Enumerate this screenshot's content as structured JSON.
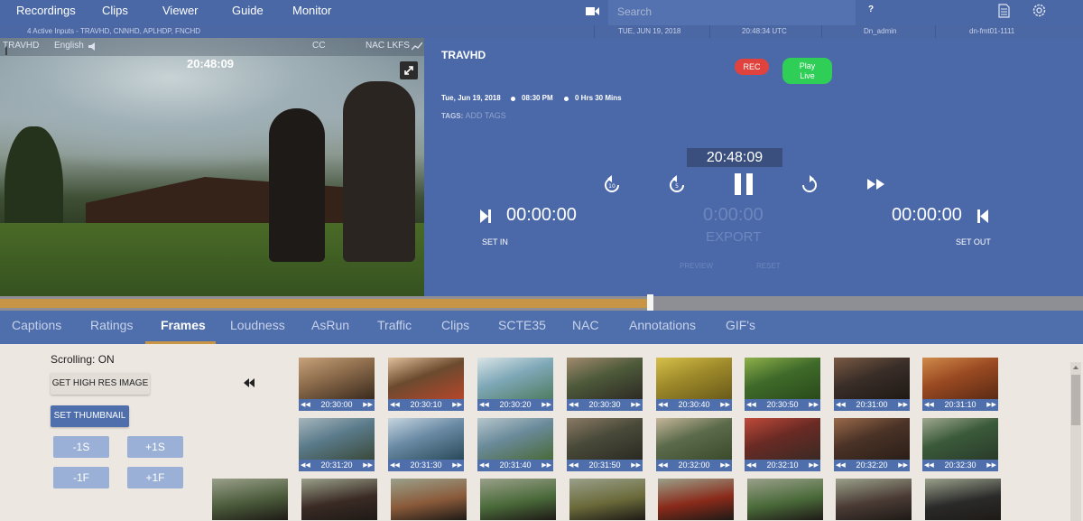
{
  "nav": {
    "items": [
      "Recordings",
      "Clips",
      "Viewer",
      "Guide",
      "Monitor"
    ],
    "search_placeholder": "Search",
    "help": "?"
  },
  "status": {
    "inputs": "4 Active Inputs - TRAVHD, CNNHD, APLHDP, FNCHD",
    "date": "TUE, JUN 19, 2018",
    "time": "20:48:34 UTC",
    "user": "Dn_admin",
    "host": "dn-fmt01-1111"
  },
  "video": {
    "channel": "TRAVHD",
    "language": "English",
    "cc": "CC",
    "nac": "NAC LKFS",
    "timecode": "20:48:09"
  },
  "controls": {
    "channel": "TRAVHD",
    "rec": "REC",
    "play_live": [
      "Play",
      "Live"
    ],
    "date": "Tue, Jun 19, 2018",
    "time": "08:30 PM",
    "duration": "0 Hrs 30 Mins",
    "tags_label": "TAGS:",
    "add_tags": "ADD TAGS",
    "clock": "20:48:09",
    "set_in_time": "00:00:00",
    "set_in": "SET IN",
    "export_time": "0:00:00",
    "export": "EXPORT",
    "preview": "PREVIEW",
    "reset": "RESET",
    "set_out_time": "00:00:00",
    "set_out": "SET OUT"
  },
  "timeline": {
    "progress": 0.6
  },
  "tabs": [
    "Captions",
    "Ratings",
    "Frames",
    "Loudness",
    "AsRun",
    "Traffic",
    "Clips",
    "SCTE35",
    "NAC",
    "Annotations",
    "GIF's"
  ],
  "active_tab": "Frames",
  "frames_panel": {
    "scrolling": "Scrolling: ON",
    "high_res": "GET HIGH RES IMAGE",
    "set_thumbnail": "SET THUMBNAIL",
    "minus_1s": "-1S",
    "plus_1s": "+1S",
    "minus_1f": "-1F",
    "plus_1f": "+1F"
  },
  "thumbnails": {
    "row1": [
      "20:30:00",
      "20:30:10",
      "20:30:20",
      "20:30:30",
      "20:30:40",
      "20:30:50",
      "20:31:00",
      "20:31:10"
    ],
    "row2": [
      "20:31:20",
      "20:31:30",
      "20:31:40",
      "20:31:50",
      "20:32:00",
      "20:32:10",
      "20:32:20",
      "20:32:30"
    ]
  },
  "colors": {
    "nav_bg": "#4a68a6",
    "panel_bg": "#4b69a9",
    "accent": "#c89445",
    "rec": "#e0433e",
    "live": "#2fce57"
  }
}
